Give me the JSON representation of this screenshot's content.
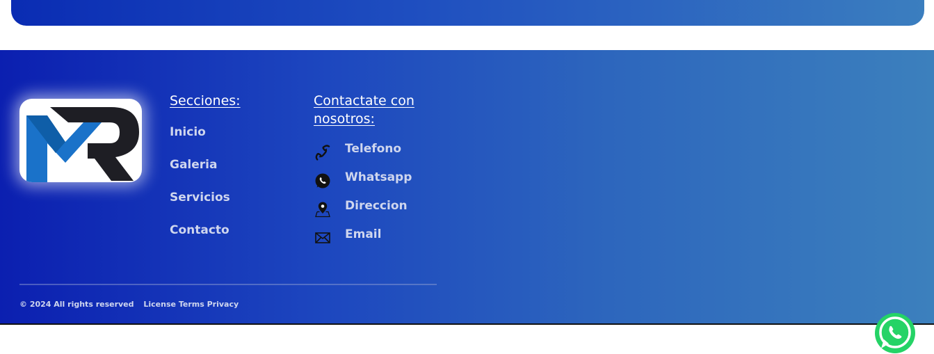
{
  "footer": {
    "sections": {
      "title": "Secciones:",
      "items": [
        {
          "label": "Inicio"
        },
        {
          "label": "Galeria"
        },
        {
          "label": "Servicios"
        },
        {
          "label": "Contacto"
        }
      ]
    },
    "contact": {
      "title": "Contactate con nosotros:",
      "items": [
        {
          "label": "Telefono",
          "icon": "phone-icon"
        },
        {
          "label": "Whatsapp",
          "icon": "whatsapp-icon"
        },
        {
          "label": "Direccion",
          "icon": "map-pin-icon"
        },
        {
          "label": "Email",
          "icon": "envelope-icon"
        }
      ]
    },
    "copyright": "© 2024 All rights reserved",
    "legal_links": [
      "License",
      "Terms",
      "Privacy"
    ]
  },
  "colors": {
    "footer_gradient_start": "#0b1fb0",
    "footer_gradient_end": "#3c80bd",
    "link_text": "#cfd6ee",
    "whatsapp_green": "#25d366"
  }
}
